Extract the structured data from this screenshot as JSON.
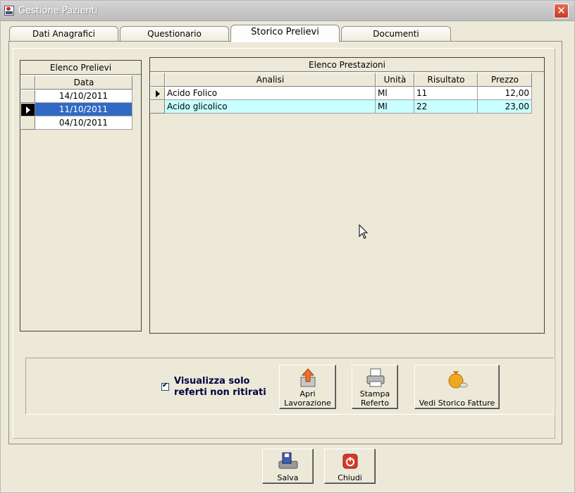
{
  "window": {
    "title": "Gestione Pazienti",
    "close_glyph": "✕"
  },
  "tabs": [
    {
      "label": "Dati Anagrafici",
      "active": false
    },
    {
      "label": "Questionario",
      "active": false
    },
    {
      "label": "Storico Prelievi",
      "active": true
    },
    {
      "label": "Documenti",
      "active": false
    }
  ],
  "prelievi": {
    "caption": "Elenco Prelievi",
    "column": "Data",
    "rows": [
      "14/10/2011",
      "11/10/2011",
      "04/10/2011"
    ],
    "selected_index": 1
  },
  "prestazioni": {
    "caption": "Elenco Prestazioni",
    "columns": {
      "analisi": "Analisi",
      "unita": "Unità",
      "risultato": "Risultato",
      "prezzo": "Prezzo"
    },
    "rows": [
      {
        "analisi": "Acido Folico",
        "unita": "Ml",
        "risultato": "11",
        "prezzo": "12,00"
      },
      {
        "analisi": "Acido glicolico",
        "unita": "Ml",
        "risultato": "22",
        "prezzo": "23,00"
      }
    ]
  },
  "options": {
    "checkbox_line1": "Visualizza solo",
    "checkbox_line2": "referti non ritirati",
    "checked": true
  },
  "actions": {
    "apri_line1": "Apri",
    "apri_line2": "Lavorazione",
    "stampa_line1": "Stampa",
    "stampa_line2": "Referto",
    "fatture": "Vedi Storico Fatture"
  },
  "footer": {
    "salva": "Salva",
    "chiudi": "Chiudi"
  },
  "colors": {
    "selection": "#316ac5",
    "highlight_row": "#c8ffff",
    "title_text": "#ffffff"
  }
}
